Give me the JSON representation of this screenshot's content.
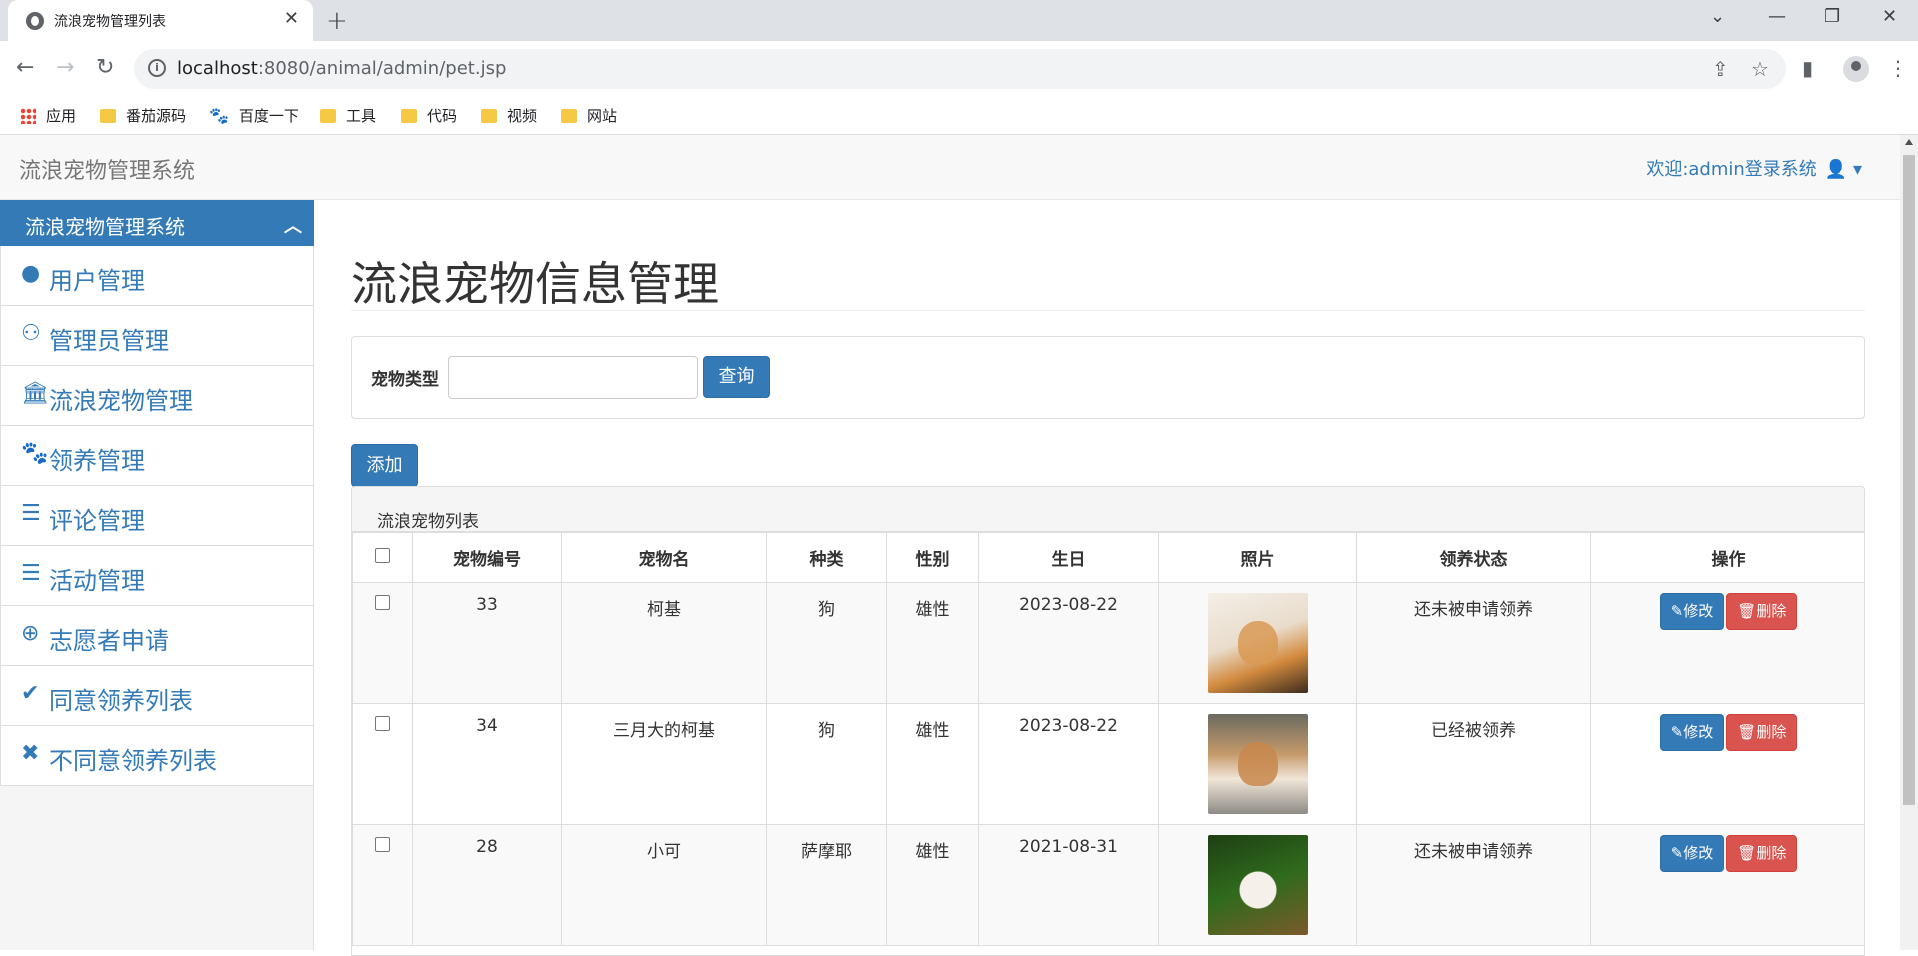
{
  "browser": {
    "tab_title": "流浪宠物管理列表",
    "url_host": "localhost",
    "url_rest": ":8080/animal/admin/pet.jsp",
    "bookmarks": [
      {
        "label": "应用",
        "icon": "apps-grid-icon"
      },
      {
        "label": "番茄源码",
        "icon": "folder-icon"
      },
      {
        "label": "百度一下",
        "icon": "baidu-paw-icon"
      },
      {
        "label": "工具",
        "icon": "folder-icon"
      },
      {
        "label": "代码",
        "icon": "folder-icon"
      },
      {
        "label": "视频",
        "icon": "folder-icon"
      },
      {
        "label": "网站",
        "icon": "folder-icon"
      }
    ]
  },
  "navbar": {
    "brand": "流浪宠物管理系统",
    "welcome": "欢迎:admin登录系统"
  },
  "sidebar": {
    "header": "流浪宠物管理系统",
    "items": [
      {
        "label": "用户管理",
        "icon": "user-icon"
      },
      {
        "label": "管理员管理",
        "icon": "users-icon"
      },
      {
        "label": "流浪宠物管理",
        "icon": "bank-icon"
      },
      {
        "label": "领养管理",
        "icon": "paw-icon"
      },
      {
        "label": "评论管理",
        "icon": "list-icon"
      },
      {
        "label": "活动管理",
        "icon": "tasks-icon"
      },
      {
        "label": "志愿者申请",
        "icon": "plus-circle-icon"
      },
      {
        "label": "同意领养列表",
        "icon": "check-icon"
      },
      {
        "label": "不同意领养列表",
        "icon": "times-icon"
      }
    ]
  },
  "main": {
    "title": "流浪宠物信息管理",
    "search": {
      "label": "宠物类型",
      "value": "",
      "button": "查询"
    },
    "add_button": "添加",
    "list_title": "流浪宠物列表",
    "columns": [
      "宠物编号",
      "宠物名",
      "种类",
      "性别",
      "生日",
      "照片",
      "领养状态",
      "操作"
    ],
    "rows": [
      {
        "id": "33",
        "name": "柯基",
        "kind": "狗",
        "sex": "雄性",
        "birthday": "2023-08-22",
        "status": "还未被申请领养",
        "edit": "修改",
        "delete": "删除"
      },
      {
        "id": "34",
        "name": "三月大的柯基",
        "kind": "狗",
        "sex": "雄性",
        "birthday": "2023-08-22",
        "status": "已经被领养",
        "edit": "修改",
        "delete": "删除"
      },
      {
        "id": "28",
        "name": "小可",
        "kind": "萨摩耶",
        "sex": "雄性",
        "birthday": "2021-08-31",
        "status": "还未被申请领养",
        "edit": "修改",
        "delete": "删除"
      }
    ]
  },
  "colors": {
    "primary": "#337ab7",
    "danger": "#d9534f",
    "navbar_bg": "#f8f8f8"
  }
}
